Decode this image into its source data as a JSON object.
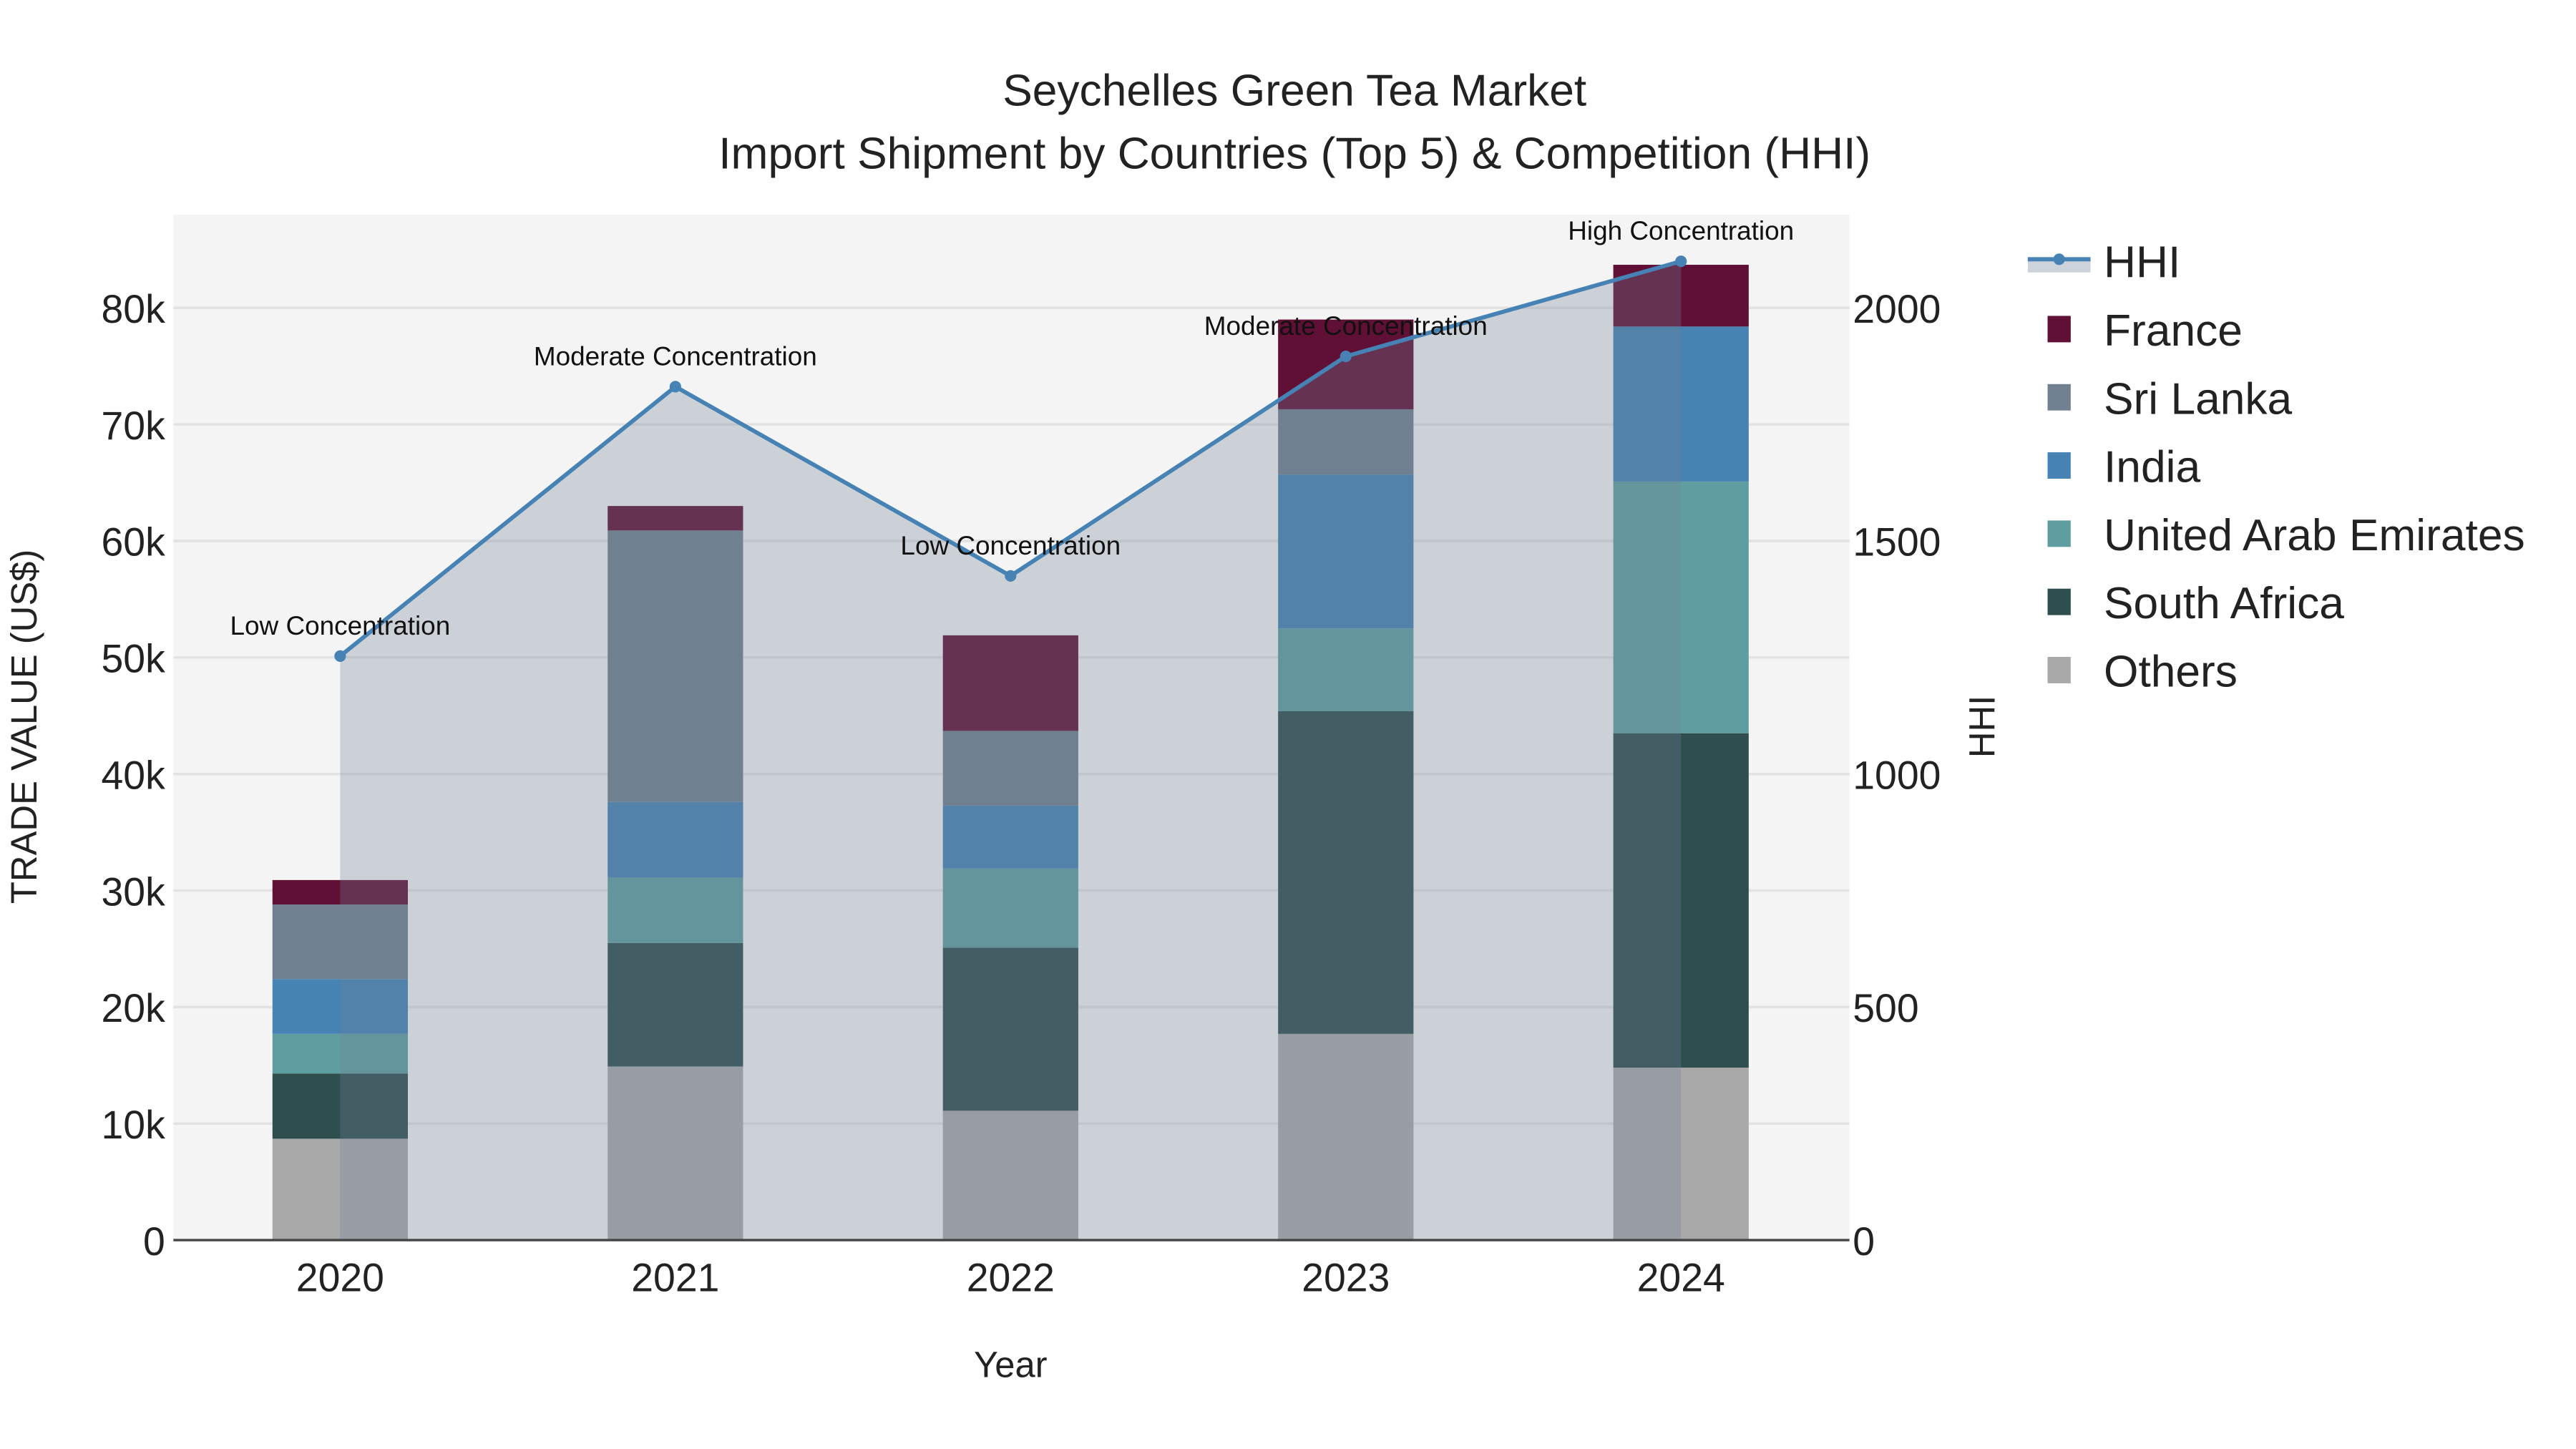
{
  "chart_data": {
    "type": "bar",
    "title": "Seychelles Green Tea Market",
    "subtitle": "Import Shipment by Countries (Top 5) & Competition (HHI)",
    "xlabel": "Year",
    "ylabel": "TRADE VALUE (US$)",
    "y2label": "HHI",
    "categories": [
      "2020",
      "2021",
      "2022",
      "2023",
      "2024"
    ],
    "ylim": [
      0,
      88000
    ],
    "y2lim": [
      0,
      2200
    ],
    "yticks": [
      0,
      10000,
      20000,
      30000,
      40000,
      50000,
      60000,
      70000,
      80000
    ],
    "ytick_labels": [
      "0",
      "10k",
      "20k",
      "30k",
      "40k",
      "50k",
      "60k",
      "70k",
      "80k"
    ],
    "y2ticks": [
      0,
      500,
      1000,
      1500,
      2000
    ],
    "y2tick_labels": [
      "0",
      "500",
      "1000",
      "1500",
      "2000"
    ],
    "stacked": true,
    "series": [
      {
        "name": "Others",
        "color": "#a9a9a9",
        "values": [
          8700,
          14900,
          11100,
          17700,
          14800
        ]
      },
      {
        "name": "South Africa",
        "color": "#2f4f4f",
        "values": [
          5600,
          10600,
          14000,
          27700,
          28700
        ]
      },
      {
        "name": "United Arab Emirates",
        "color": "#5f9ea0",
        "values": [
          3400,
          5600,
          6800,
          7100,
          21600
        ]
      },
      {
        "name": "India",
        "color": "#4682b4",
        "values": [
          4700,
          6500,
          5400,
          13200,
          13300
        ]
      },
      {
        "name": "Sri Lanka",
        "color": "#708090",
        "values": [
          6400,
          23300,
          6400,
          5600,
          0
        ]
      },
      {
        "name": "France",
        "color": "#601035",
        "values": [
          2100,
          2100,
          8200,
          7700,
          5300
        ]
      }
    ],
    "line": {
      "name": "HHI",
      "color": "#4682b4",
      "axis": "right",
      "values": [
        1253,
        1831,
        1425,
        1896,
        2100
      ],
      "annotations": [
        "Low Concentration",
        "Moderate Concentration",
        "Low Concentration",
        "Moderate Concentration",
        "High Concentration"
      ]
    },
    "legend_order": [
      "HHI",
      "France",
      "Sri Lanka",
      "India",
      "United Arab Emirates",
      "South Africa",
      "Others"
    ],
    "legend_position": "right",
    "grid": true
  }
}
